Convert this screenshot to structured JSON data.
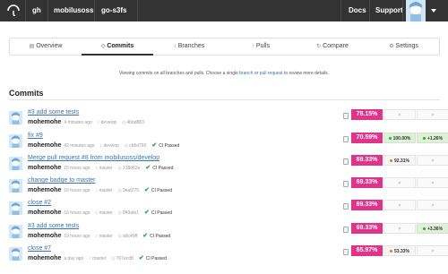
{
  "topbar": {
    "crumbs": [
      "gh",
      "mobilusoss",
      "go-s3fs"
    ],
    "links": [
      "Docs",
      "Support"
    ]
  },
  "tabs": [
    {
      "label": "Overview",
      "icon": "book-icon",
      "glyph": "▤",
      "active": false
    },
    {
      "label": "Commits",
      "icon": "commit-icon",
      "glyph": "◇",
      "active": true
    },
    {
      "label": "Branches",
      "icon": "branch-icon",
      "glyph": "↕",
      "active": false
    },
    {
      "label": "Pulls",
      "icon": "pull-request-icon",
      "glyph": "↑",
      "active": false
    },
    {
      "label": "Compare",
      "icon": "compare-icon",
      "glyph": "↻",
      "active": false
    },
    {
      "label": "Settings",
      "icon": "gear-icon",
      "glyph": "⚙",
      "active": false
    }
  ],
  "info": {
    "before": "Viewing commits on all branches and pulls. Choose a single ",
    "link1": "branch",
    "mid": " or ",
    "link2": "pull request",
    "after": " to review more details."
  },
  "section_title": "Commits",
  "commits": [
    {
      "message": "#3 add some tests",
      "author": "mohemohe",
      "time": "4 minutes ago",
      "branch": "develop",
      "sha": "4bbd883",
      "ci": "",
      "coverage": "78.15%",
      "diff1": "",
      "diff1_type": "none",
      "diff2": "",
      "diff2_type": "none"
    },
    {
      "message": "fix #9",
      "author": "mohemohe",
      "time": "42 minutes ago",
      "branch": "develop",
      "sha": "cb5d790",
      "ci": "CI Passed",
      "coverage": "70.59%",
      "diff1": "100.00%",
      "diff1_type": "pos",
      "diff2": "+1.26%",
      "diff2_type": "pos"
    },
    {
      "message": "Merge pull request #8 from mobilusoss/develop",
      "author": "mohemohe",
      "time": "15 hours ago",
      "branch": "master",
      "sha": "138d62e",
      "ci": "CI Passed",
      "coverage": "69.33%",
      "diff1": "92.31%",
      "diff1_type": "neg",
      "diff2": "",
      "diff2_type": "none"
    },
    {
      "message": "change badge to master",
      "author": "mohemohe",
      "time": "16 hours ago",
      "branch": "master",
      "sha": "9eaf275",
      "ci": "CI Passed",
      "coverage": "69.33%",
      "diff1": "",
      "diff1_type": "none",
      "diff2": "",
      "diff2_type": "none"
    },
    {
      "message": "close #2",
      "author": "mohemohe",
      "time": "16 hours ago",
      "branch": "master",
      "sha": "849afe1",
      "ci": "CI Passed",
      "coverage": "69.33%",
      "diff1": "",
      "diff1_type": "none",
      "diff2": "",
      "diff2_type": "none"
    },
    {
      "message": "#3 add some tests",
      "author": "mohemohe",
      "time": "19 hours ago",
      "branch": "master",
      "sha": "a9c49ff",
      "ci": "CI Passed",
      "coverage": "69.33%",
      "diff1": "",
      "diff1_type": "none",
      "diff2": "+3.36%",
      "diff2_type": "pos"
    },
    {
      "message": "close #7",
      "author": "mohemohe",
      "time": "a day ago",
      "branch": "master",
      "sha": "707ecd8",
      "ci": "CI Passed",
      "coverage": "65.97%",
      "diff1": "53.33%",
      "diff1_type": "neg",
      "diff2": "",
      "diff2_type": "none"
    }
  ],
  "colors": {
    "topbar": "#333333",
    "coverage": "#e0338a",
    "link": "#3b73af",
    "pass": "#2aa63b"
  }
}
